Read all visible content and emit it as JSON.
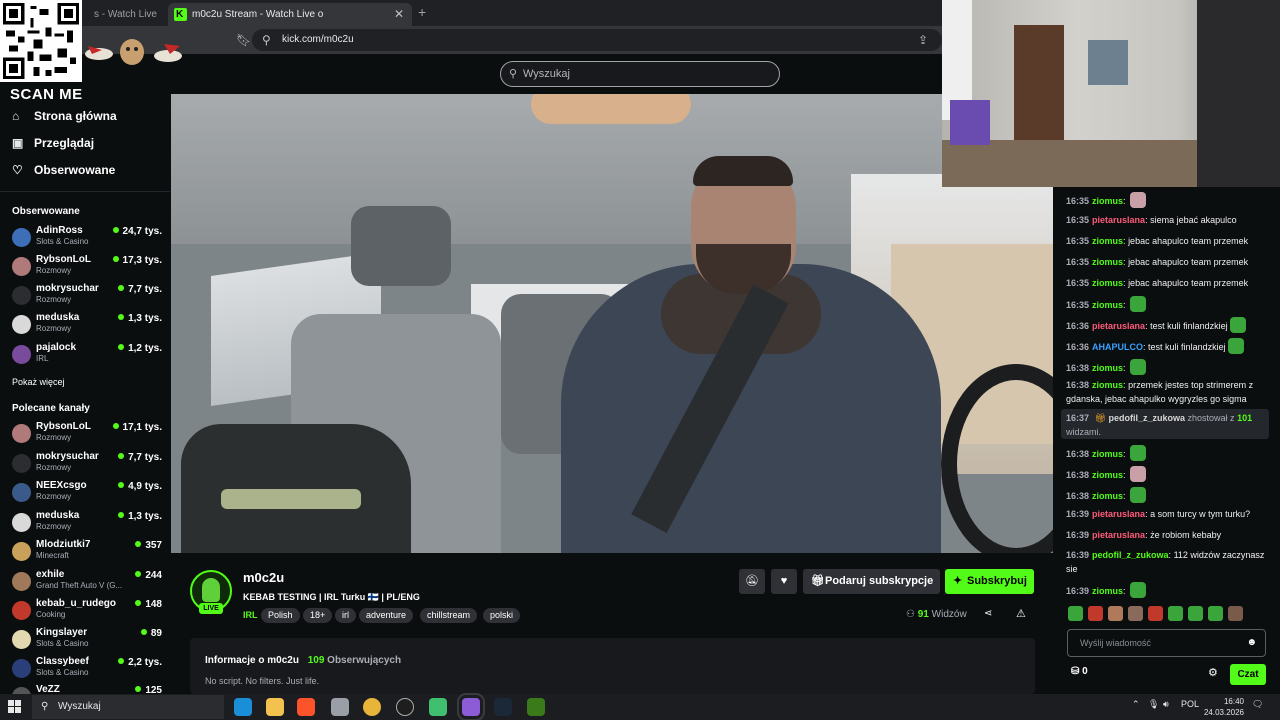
{
  "overlay": {
    "scan_text": "SCAN ME"
  },
  "browser": {
    "tabs": [
      {
        "label": "s - Watch Live on K"
      },
      {
        "label": "m0c2u Stream - Watch Live o"
      }
    ],
    "new_tab": "+",
    "url": "kick.com/m0c2u"
  },
  "header": {
    "search_placeholder": "Wyszukaj"
  },
  "sidebar": {
    "nav": [
      {
        "label": "Strona główna",
        "icon": "home-icon"
      },
      {
        "label": "Przeglądaj",
        "icon": "browse-icon"
      },
      {
        "label": "Obserwowane",
        "icon": "heart-icon"
      }
    ],
    "following_title": "Obserwowane",
    "following": [
      {
        "name": "AdinRoss",
        "category": "Slots & Casino",
        "viewers": "24,7 tys.",
        "color": "#3d6fb8"
      },
      {
        "name": "RybsonLoL",
        "category": "Rozmowy",
        "viewers": "17,3 tys.",
        "color": "#b07a7a"
      },
      {
        "name": "mokrysuchar",
        "category": "Rozmowy",
        "viewers": "7,7 tys.",
        "color": "#2b2d31"
      },
      {
        "name": "meduska",
        "category": "Rozmowy",
        "viewers": "1,3 tys.",
        "color": "#d9d9d9"
      },
      {
        "name": "pajalock",
        "category": "IRL",
        "viewers": "1,2 tys.",
        "color": "#7a4a9c"
      }
    ],
    "show_more": "Pokaż więcej",
    "recommended_title": "Polecane kanały",
    "recommended": [
      {
        "name": "RybsonLoL",
        "category": "Rozmowy",
        "viewers": "17,1 tys.",
        "color": "#b07a7a"
      },
      {
        "name": "mokrysuchar",
        "category": "Rozmowy",
        "viewers": "7,7 tys.",
        "color": "#2b2d31"
      },
      {
        "name": "NEEXcsgo",
        "category": "Rozmowy",
        "viewers": "4,9 tys.",
        "color": "#3a5a8a"
      },
      {
        "name": "meduska",
        "category": "Rozmowy",
        "viewers": "1,3 tys.",
        "color": "#d9d9d9"
      },
      {
        "name": "Mlodziutki7",
        "category": "Minecraft",
        "viewers": "357",
        "color": "#c9a15a"
      },
      {
        "name": "exhile",
        "category": "Grand Theft Auto V (G...",
        "viewers": "244",
        "color": "#a0785a"
      },
      {
        "name": "kebab_u_rudego",
        "category": "Cooking",
        "viewers": "148",
        "color": "#c0392b"
      },
      {
        "name": "Kingslayer",
        "category": "Slots & Casino",
        "viewers": "89",
        "color": "#e3d9b0"
      },
      {
        "name": "Classybeef",
        "category": "Slots & Casino",
        "viewers": "2,2 tys.",
        "color": "#2a3f7a"
      },
      {
        "name": "VeZZ",
        "category": "",
        "viewers": "125",
        "color": "#555"
      }
    ]
  },
  "stream": {
    "name": "m0c2u",
    "live_badge": "LIVE",
    "title": "KEBAB TESTING | IRL Turku 🇫🇮 | PL/ENG",
    "category": "IRL",
    "tags": [
      "Polish",
      "18+",
      "irl",
      "adventure",
      "chillstream",
      "polski"
    ],
    "gift_label": "Podaruj subskrypcje",
    "subscribe_label": "Subskrybuj",
    "viewers_count": "91",
    "viewers_label": "Widzów"
  },
  "about": {
    "title": "Informacje o m0c2u",
    "followers_count": "109",
    "followers_label": "Obserwujących",
    "description": "No script. No filters. Just life."
  },
  "chat": {
    "messages": [
      {
        "time": "16:35",
        "user": "ziomus",
        "color": "#53fc18",
        "text": "",
        "emote": "pic"
      },
      {
        "time": "16:35",
        "user": "pietaruslana",
        "color": "#ff5a7a",
        "text": "siema jebać akapulco",
        "emote": ""
      },
      {
        "time": "16:35",
        "user": "ziomus",
        "color": "#53fc18",
        "text": "jebac ahapulco team przemek",
        "emote": ""
      },
      {
        "time": "16:35",
        "user": "ziomus",
        "color": "#53fc18",
        "text": "jebac ahapulco team przemek",
        "emote": ""
      },
      {
        "time": "16:35",
        "user": "ziomus",
        "color": "#53fc18",
        "text": "jebac ahapulco team przemek",
        "emote": ""
      },
      {
        "time": "16:35",
        "user": "ziomus",
        "color": "#53fc18",
        "text": "",
        "emote": "pepe"
      },
      {
        "time": "16:36",
        "user": "pietaruslana",
        "color": "#ff5a7a",
        "text": "test kuli finlandzkiej",
        "emote": "pepe"
      },
      {
        "time": "16:36",
        "user": "AHAPULCO",
        "color": "#3aa0ff",
        "text": "test kuli finlandzkiej",
        "emote": "pepe"
      },
      {
        "time": "16:38",
        "user": "ziomus",
        "color": "#53fc18",
        "text": "",
        "emote": "pepe"
      },
      {
        "time": "16:38",
        "user": "ziomus",
        "color": "#53fc18",
        "text": "przemek jestes top strimerem z gdanska, jebac ahapulko wygryzles go sigma",
        "emote": ""
      }
    ],
    "gift": {
      "time": "16:37",
      "user": "pedofil_z_zukowa",
      "action": "zhostował z",
      "count": "101",
      "suffix": "widzami."
    },
    "messages2": [
      {
        "time": "16:38",
        "user": "ziomus",
        "color": "#53fc18",
        "text": "",
        "emote": "pepe"
      },
      {
        "time": "16:38",
        "user": "ziomus",
        "color": "#53fc18",
        "text": "",
        "emote": "pic"
      },
      {
        "time": "16:38",
        "user": "ziomus",
        "color": "#53fc18",
        "text": "",
        "emote": "pepe"
      },
      {
        "time": "16:39",
        "user": "pietaruslana",
        "color": "#ff5a7a",
        "text": "a som turcy w tym turku?",
        "emote": ""
      },
      {
        "time": "16:39",
        "user": "pietaruslana",
        "color": "#ff5a7a",
        "text": "że robiom kebaby",
        "emote": ""
      },
      {
        "time": "16:39",
        "user": "pedofil_z_zukowa",
        "color": "#53fc18",
        "text": "112 widzów zaczynasz sie",
        "emote": ""
      },
      {
        "time": "16:39",
        "user": "ziomus",
        "color": "#53fc18",
        "text": "",
        "emote": "pepe"
      }
    ],
    "input_placeholder": "Wyślij wiadomość",
    "points": "0",
    "send_label": "Czat"
  },
  "taskbar": {
    "search_label": "Wyszukaj",
    "language": "POL",
    "time": "16:40",
    "date": "24.03.2026"
  },
  "colors": {
    "accent": "#53fc18",
    "background": "#0b0e0f"
  }
}
